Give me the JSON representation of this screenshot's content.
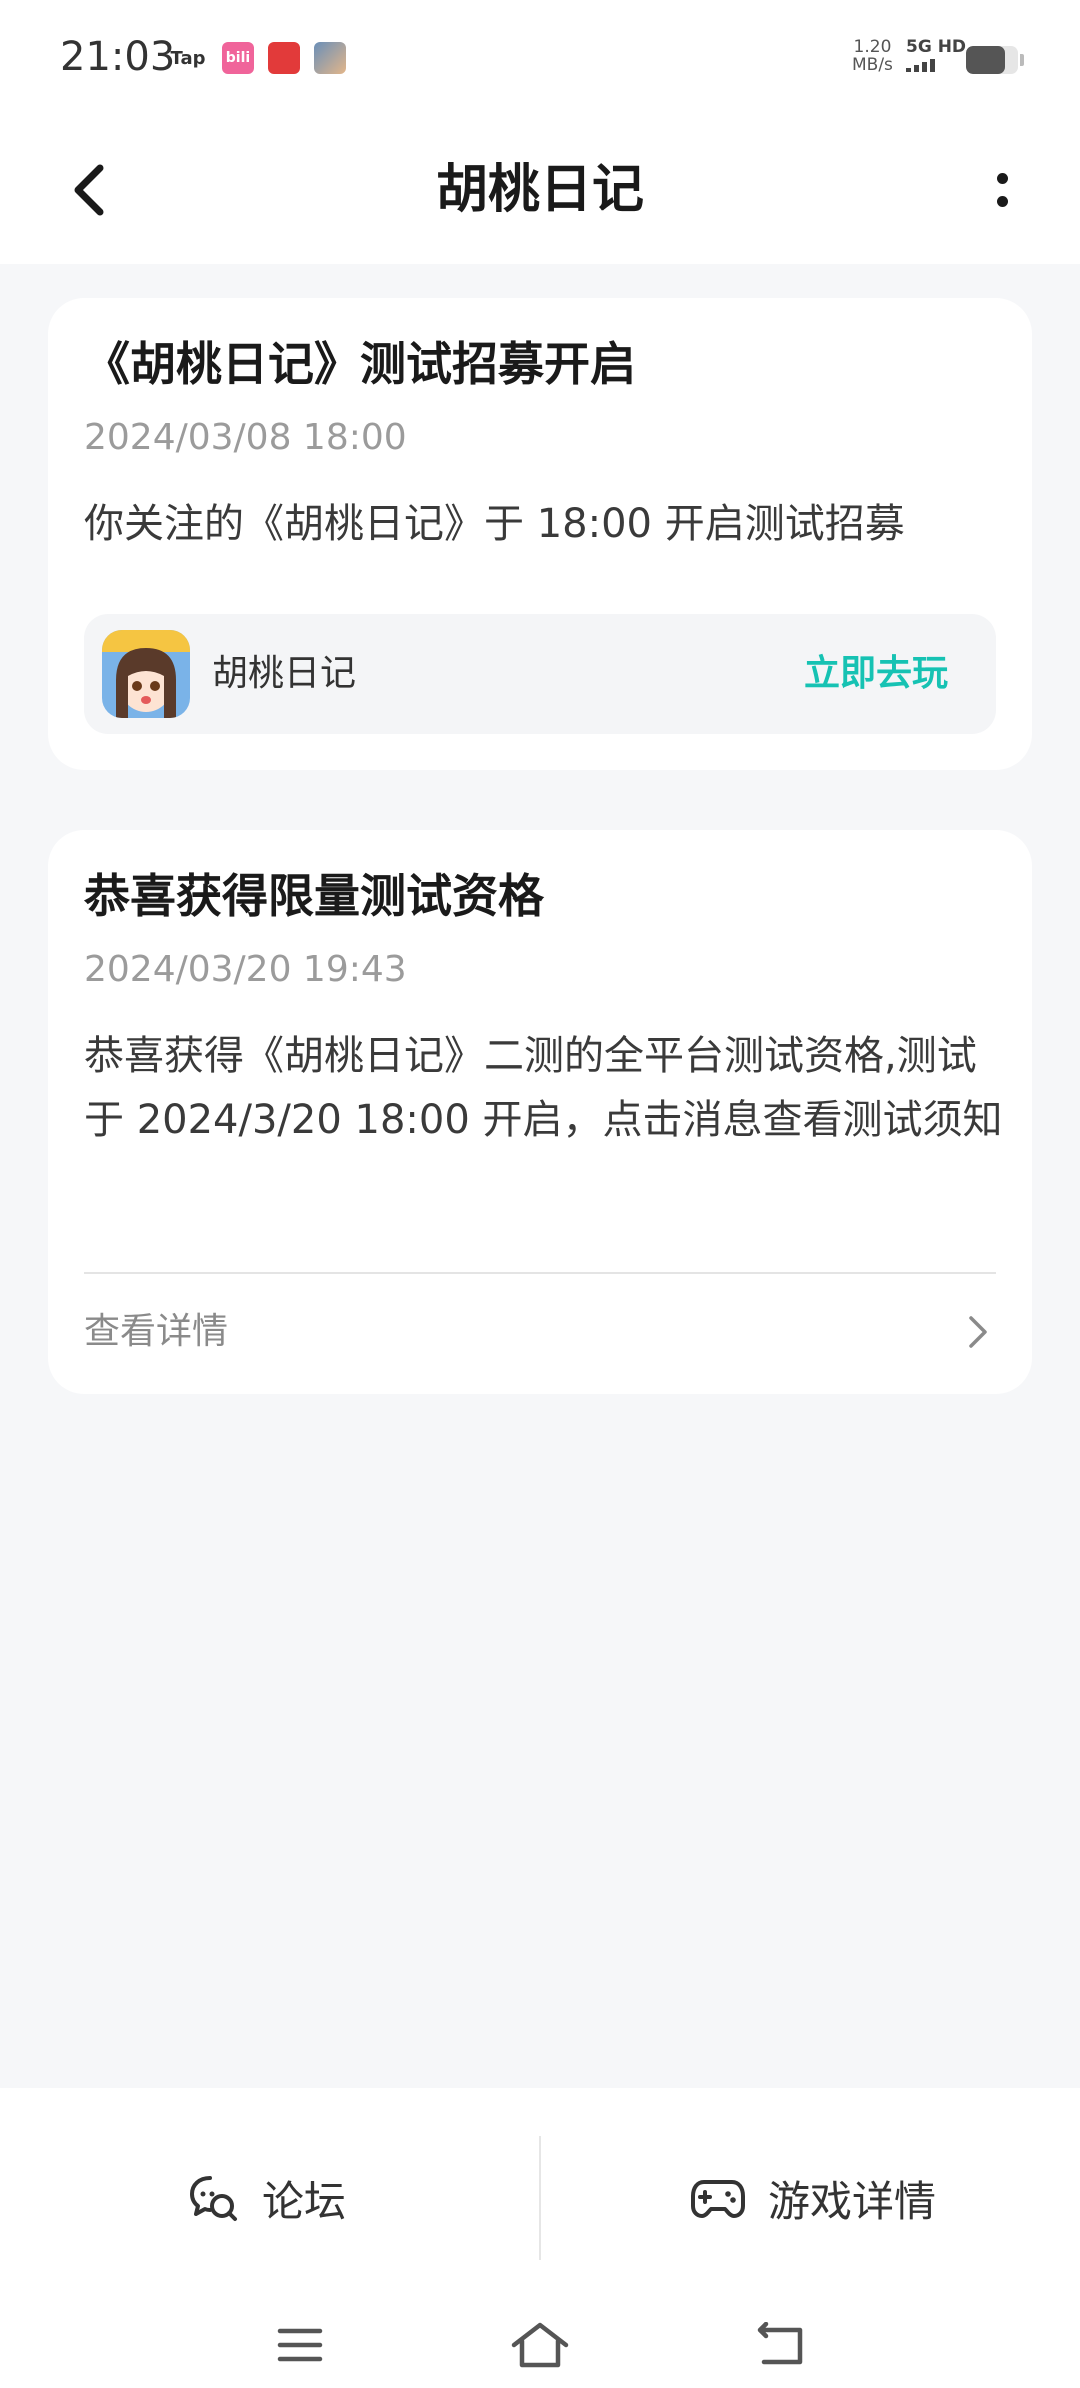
{
  "status_bar": {
    "time": "21:03",
    "notifications": [
      {
        "name": "taptap-icon",
        "label": "Tap"
      },
      {
        "name": "bilibili-icon",
        "label": "bili"
      },
      {
        "name": "red-app-icon",
        "label": ""
      },
      {
        "name": "game-app-icon",
        "label": ""
      }
    ],
    "net_speed_value": "1.20",
    "net_speed_unit": "MB/s",
    "signal_label": "5G HD",
    "battery_level": 0.75
  },
  "nav": {
    "title": "胡桃日记"
  },
  "messages": [
    {
      "title": "《胡桃日记》测试招募开启",
      "time": "2024/03/08 18:00",
      "body": "你关注的《胡桃日记》于 18:00 开启测试招募",
      "game_name": "胡桃日记",
      "action_label": "立即去玩"
    },
    {
      "title": "恭喜获得限量测试资格",
      "time": "2024/03/20 19:43",
      "body": "恭喜获得《胡桃日记》二测的全平台测试资格,测试于 2024/3/20 18:00 开启，点击消息查看测试须知",
      "link_label": "查看详情"
    }
  ],
  "bottom_bar": {
    "forum_label": "论坛",
    "game_details_label": "游戏详情"
  },
  "colors": {
    "accent": "#16c2b3",
    "background": "#f6f7f9",
    "card": "#ffffff"
  }
}
